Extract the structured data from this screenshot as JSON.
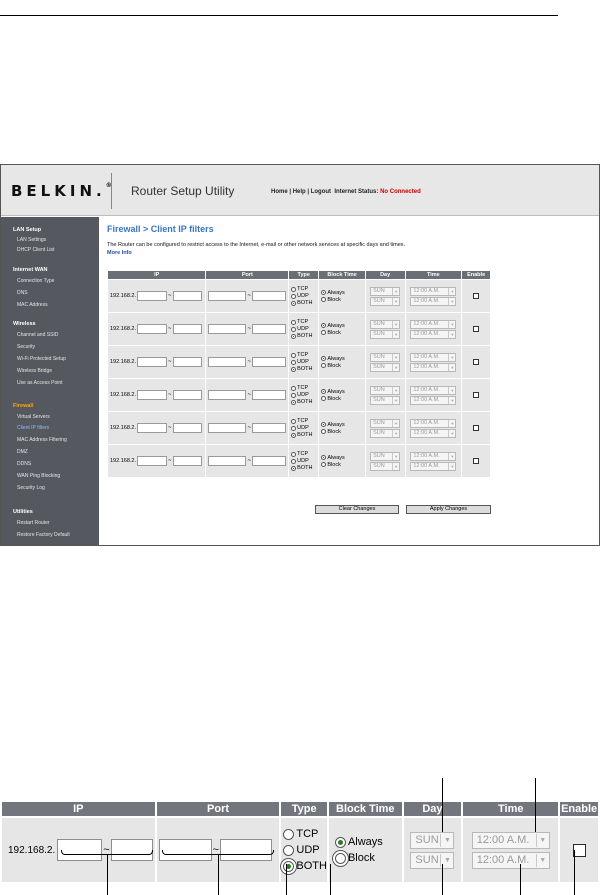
{
  "header": {
    "logo": "BELKIN",
    "logo_mark": ".",
    "title": "Router Setup Utility",
    "links": [
      "Home",
      "Help",
      "Logout"
    ],
    "status_label": "Internet Status:",
    "status_value": "No Connected"
  },
  "sidebar": {
    "sections": [
      {
        "title": "LAN Setup",
        "items": [
          "LAN Settings",
          "DHCP Client List"
        ]
      },
      {
        "title": "Internet WAN",
        "items": [
          "Connection Type",
          "DNS",
          "MAC Address"
        ]
      },
      {
        "title": "Wireless",
        "items": [
          "Channel and SSID",
          "Security",
          "Wi-Fi Protected Setup",
          "Wireless Bridge",
          "Use as Access Point"
        ]
      },
      {
        "title": "Firewall",
        "items": [
          "Virtual Servers",
          "Client IP filters",
          "MAC Address Filtering",
          "DMZ",
          "DDNS",
          "WAN Ping Blocking",
          "Security Log"
        ]
      },
      {
        "title": "Utilities",
        "items": [
          "Restart Router",
          "Restore Factory Default"
        ]
      }
    ],
    "active_item": "Client IP filters"
  },
  "content": {
    "title": "Firewall > Client IP filters",
    "intro": "The Router can be configured to restrict access to the Internet, e-mail or other network services at specific days and times.",
    "more_info": "More Info"
  },
  "table": {
    "headers": [
      "IP",
      "Port",
      "Type",
      "Block Time",
      "Day",
      "Time",
      "Enable"
    ],
    "ip_prefix": "192.168.2.",
    "separator": "~",
    "type_options": [
      "TCP",
      "UDP",
      "BOTH"
    ],
    "block_options": [
      "Always",
      "Block"
    ],
    "day_values": [
      "SUN",
      "SUN"
    ],
    "time_values": [
      "12:00 A.M.",
      "12:00 A.M."
    ],
    "rows": [
      {
        "type_selected": "BOTH",
        "block_selected": "Always",
        "enabled": false
      },
      {
        "type_selected": "BOTH",
        "block_selected": "Always",
        "enabled": false
      },
      {
        "type_selected": "BOTH",
        "block_selected": "Always",
        "enabled": false
      },
      {
        "type_selected": "BOTH",
        "block_selected": "Always",
        "enabled": false
      },
      {
        "type_selected": "BOTH",
        "block_selected": "Always",
        "enabled": false
      },
      {
        "type_selected": "BOTH",
        "block_selected": "Always",
        "enabled": false
      }
    ]
  },
  "buttons": {
    "clear": "Clear Changes",
    "apply": "Apply Changes"
  },
  "zoom": {
    "headers": [
      "IP",
      "Port",
      "Type",
      "Block Time",
      "Day",
      "Time",
      "Enable"
    ],
    "ip_prefix": "192.168.2.",
    "separator": "~",
    "type_options": [
      "TCP",
      "UDP",
      "BOTH"
    ],
    "block_options": [
      "Always",
      "Block"
    ],
    "day_values": [
      "SUN",
      "SUN"
    ],
    "time_values": [
      "12:00 A.M.",
      "12:00 A.M."
    ]
  }
}
